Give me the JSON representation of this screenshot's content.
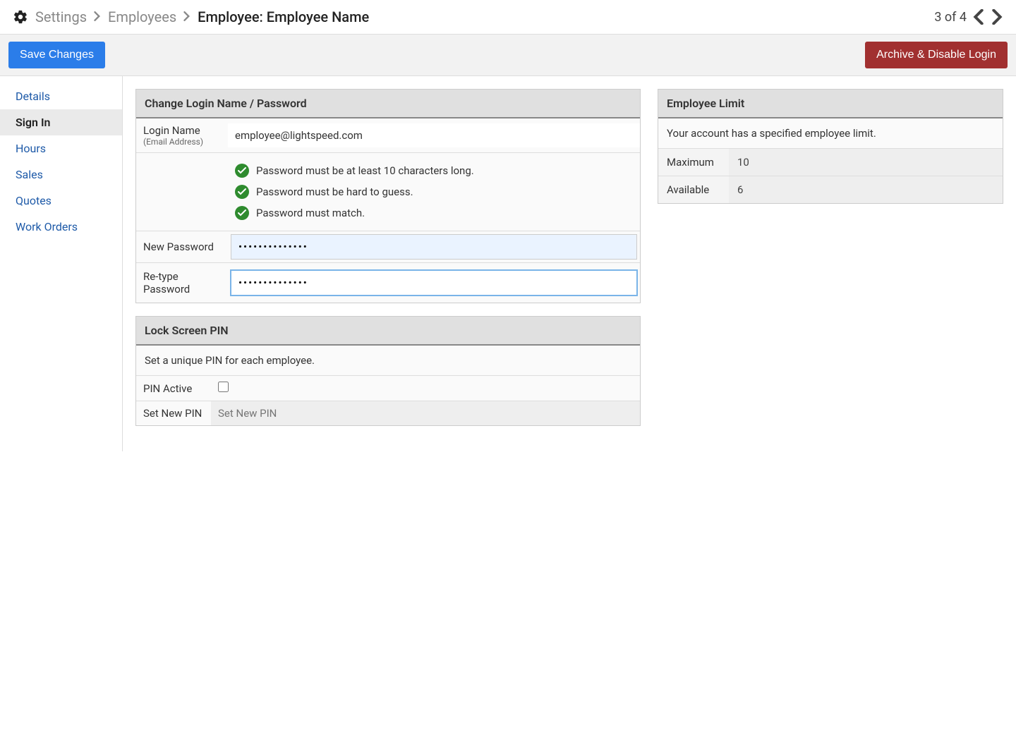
{
  "breadcrumb": {
    "settings": "Settings",
    "employees": "Employees",
    "current": "Employee:  Employee Name"
  },
  "pager": {
    "text": "3 of 4"
  },
  "toolbar": {
    "save_label": "Save Changes",
    "archive_label": "Archive & Disable Login"
  },
  "sidebar": {
    "items": [
      {
        "label": "Details",
        "active": false
      },
      {
        "label": "Sign In",
        "active": true
      },
      {
        "label": "Hours",
        "active": false
      },
      {
        "label": "Sales",
        "active": false
      },
      {
        "label": "Quotes",
        "active": false
      },
      {
        "label": "Work Orders",
        "active": false
      }
    ]
  },
  "login_panel": {
    "title": "Change Login Name / Password",
    "login_name_label": "Login Name",
    "login_name_sub": "(Email Address)",
    "login_name_value": "employee@lightspeed.com",
    "rules": [
      "Password must be at least 10 characters long.",
      "Password must be hard to guess.",
      "Password must match."
    ],
    "new_password_label": "New Password",
    "new_password_value": "••••••••••••••",
    "retype_password_label": "Re-type Password",
    "retype_password_value": "••••••••••••••"
  },
  "pin_panel": {
    "title": "Lock Screen PIN",
    "description": "Set a unique PIN for each employee.",
    "pin_active_label": "PIN Active",
    "set_pin_label": "Set New PIN",
    "set_pin_placeholder": "Set New PIN"
  },
  "limit_panel": {
    "title": "Employee Limit",
    "description": "Your account has a specified employee limit.",
    "maximum_label": "Maximum",
    "maximum_value": "10",
    "available_label": "Available",
    "available_value": "6"
  }
}
